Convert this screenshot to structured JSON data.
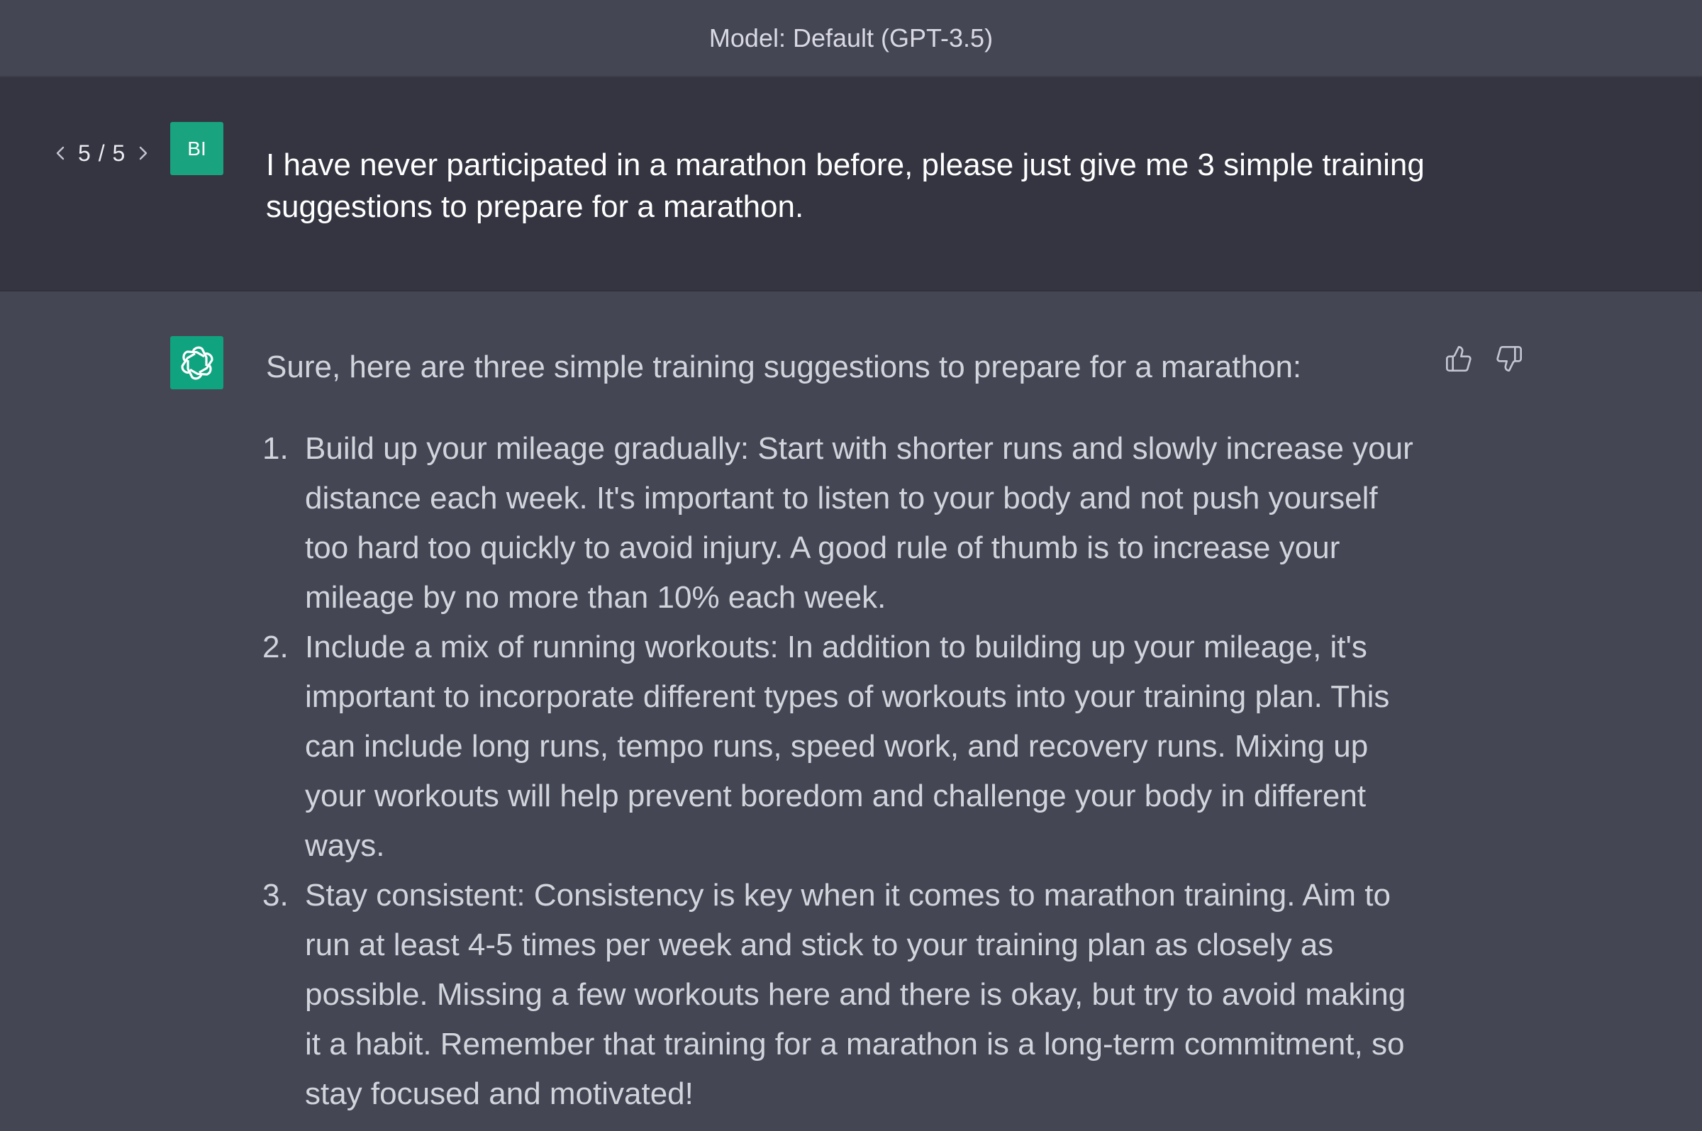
{
  "header": {
    "model_label": "Model: Default (GPT-3.5)"
  },
  "user_message": {
    "pager": {
      "prev_icon": "chevron-left-icon",
      "count": "5 / 5",
      "next_icon": "chevron-right-icon"
    },
    "avatar_initials": "BI",
    "avatar_color": "#19a37f",
    "text": "I have never participated in a marathon before, please just give me 3 simple training suggestions to prepare for a marathon."
  },
  "assistant_message": {
    "avatar_icon": "openai-logo-icon",
    "avatar_color": "#10a37f",
    "intro": "Sure, here are three simple training suggestions to prepare for a marathon:",
    "items": [
      {
        "number": "1.",
        "text": "Build up your mileage gradually: Start with shorter runs and slowly increase your distance each week. It's important to listen to your body and not push yourself too hard too quickly to avoid injury. A good rule of thumb is to increase your mileage by no more than 10% each week."
      },
      {
        "number": "2.",
        "text": "Include a mix of running workouts: In addition to building up your mileage, it's important to incorporate different types of workouts into your training plan. This can include long runs, tempo runs, speed work, and recovery runs. Mixing up your workouts will help prevent boredom and challenge your body in different ways."
      },
      {
        "number": "3.",
        "text": "Stay consistent: Consistency is key when it comes to marathon training. Aim to run at least 4-5 times per week and stick to your training plan as closely as possible. Missing a few workouts here and there is okay, but try to avoid making it a habit. Remember that training for a marathon is a long-term commitment, so stay focused and motivated!"
      }
    ],
    "feedback": {
      "thumbs_up_icon": "thumbs-up-icon",
      "thumbs_down_icon": "thumbs-down-icon"
    }
  },
  "colors": {
    "user_background": "#343541",
    "assistant_background": "#444654",
    "accent": "#10a37f"
  }
}
